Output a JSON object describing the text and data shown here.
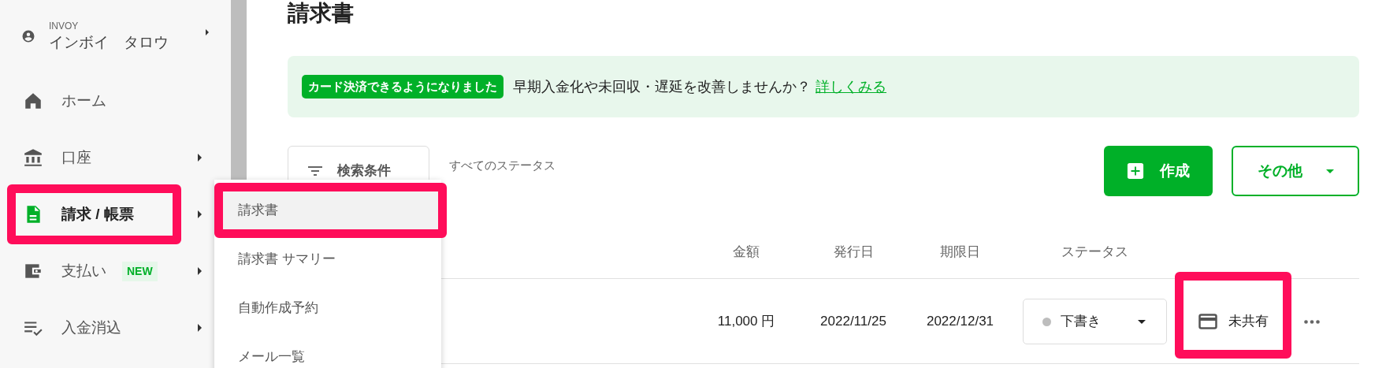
{
  "sidebar": {
    "user": {
      "organization": "INVOY",
      "name": "インボイ　タロウ"
    },
    "items": [
      {
        "label": "ホーム",
        "selected": false,
        "has_submenu": false,
        "highlighted": false
      },
      {
        "label": "口座",
        "selected": false,
        "has_submenu": true,
        "highlighted": false
      },
      {
        "label": "請求 / 帳票",
        "selected": true,
        "has_submenu": true,
        "highlighted": true
      },
      {
        "label": "支払い",
        "selected": false,
        "has_submenu": true,
        "highlighted": false,
        "badge": "NEW"
      },
      {
        "label": "入金消込",
        "selected": false,
        "has_submenu": true,
        "highlighted": false
      }
    ]
  },
  "submenu": {
    "items": [
      {
        "label": "請求書",
        "selected": true,
        "highlighted": true
      },
      {
        "label": "請求書 サマリー",
        "selected": false,
        "highlighted": false
      },
      {
        "label": "自動作成予約",
        "selected": false,
        "highlighted": false
      },
      {
        "label": "メール一覧",
        "selected": false,
        "highlighted": false
      }
    ]
  },
  "page_title": "請求書",
  "banner": {
    "badge": "カード決済できるようになりました",
    "message": "早期入金化や未回収・遅延を改善しませんか？",
    "link": "詳しくみる"
  },
  "toolbar": {
    "filter_button": "検索条件",
    "filter_summary": "すべてのステータス",
    "create_button": "作成",
    "more_button": "その他"
  },
  "table": {
    "columns": [
      "金額",
      "発行日",
      "期限日",
      "ステータス"
    ],
    "rows": [
      {
        "amount": "11,000 円",
        "issued": "2022/11/25",
        "due": "2022/12/31",
        "status": {
          "label": "下書き",
          "color": "#bdbdbd"
        },
        "share": {
          "label": "未共有",
          "highlighted": true
        }
      }
    ]
  }
}
